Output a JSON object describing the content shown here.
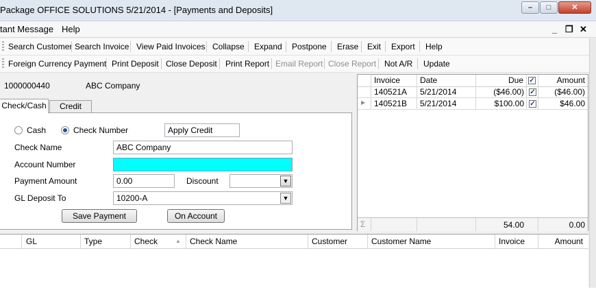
{
  "window": {
    "title": "Package OFFICE SOLUTIONS 5/21/2014 - [Payments and Deposits]",
    "minimize_glyph": "–",
    "maximize_glyph": "□",
    "close_glyph": "✕"
  },
  "menu": {
    "items": [
      "tant Message",
      "Help"
    ],
    "mdi": {
      "minimize": "_",
      "restore": "❐",
      "close": "✕"
    }
  },
  "toolbar1": [
    "Search Customer",
    "Search Invoice",
    "View Paid Invoices",
    "Collapse",
    "Expand",
    "Postpone",
    "Erase",
    "Exit",
    "Export",
    "Help"
  ],
  "toolbar2": [
    {
      "label": "Foreign Currency Payment",
      "enabled": true
    },
    {
      "label": "Print Deposit",
      "enabled": true
    },
    {
      "label": "Close Deposit",
      "enabled": true
    },
    {
      "label": "Print Report",
      "enabled": true
    },
    {
      "label": "Email Report",
      "enabled": false
    },
    {
      "label": "Close Report",
      "enabled": false
    },
    {
      "label": "Not A/R",
      "enabled": true
    },
    {
      "label": "Update",
      "enabled": true
    }
  ],
  "customer": {
    "id": "1000000440",
    "name": "ABC Company"
  },
  "tabs": [
    "Check/Cash",
    "Credit Card"
  ],
  "form": {
    "cash_label": "Cash",
    "check_number_label": "Check Number",
    "apply_credit": "Apply Credit",
    "check_name_label": "Check Name",
    "check_name_value": "ABC Company",
    "account_number_label": "Account Number",
    "account_number_value": "",
    "payment_amount_label": "Payment Amount",
    "payment_amount_value": "0.00",
    "discount_label": "Discount",
    "discount_value": "",
    "gl_deposit_label": "GL Deposit To",
    "gl_deposit_value": "10200-A",
    "save_payment": "Save Payment",
    "on_account": "On Account",
    "selected_payment_type": "Check Number"
  },
  "invoice_grid": {
    "headers": [
      "Invoice",
      "Date",
      "Due",
      "Amount"
    ],
    "rows": [
      {
        "invoice": "140521A",
        "date": "5/21/2014",
        "due": "($46.00)",
        "checked": true,
        "amount": "($46.00)"
      },
      {
        "invoice": "140521B",
        "date": "5/21/2014",
        "due": "$100.00",
        "checked": true,
        "amount": "$46.00"
      }
    ],
    "sum_symbol": "Σ",
    "total_due": "54.00",
    "total_amount": "0.00",
    "check_glyph": "✓",
    "row_pointer": "▶"
  },
  "deposit_grid": {
    "headers": [
      "GL",
      "Type",
      "Check",
      "Check Name",
      "Customer",
      "Customer Name",
      "Invoice",
      "Amount"
    ]
  }
}
